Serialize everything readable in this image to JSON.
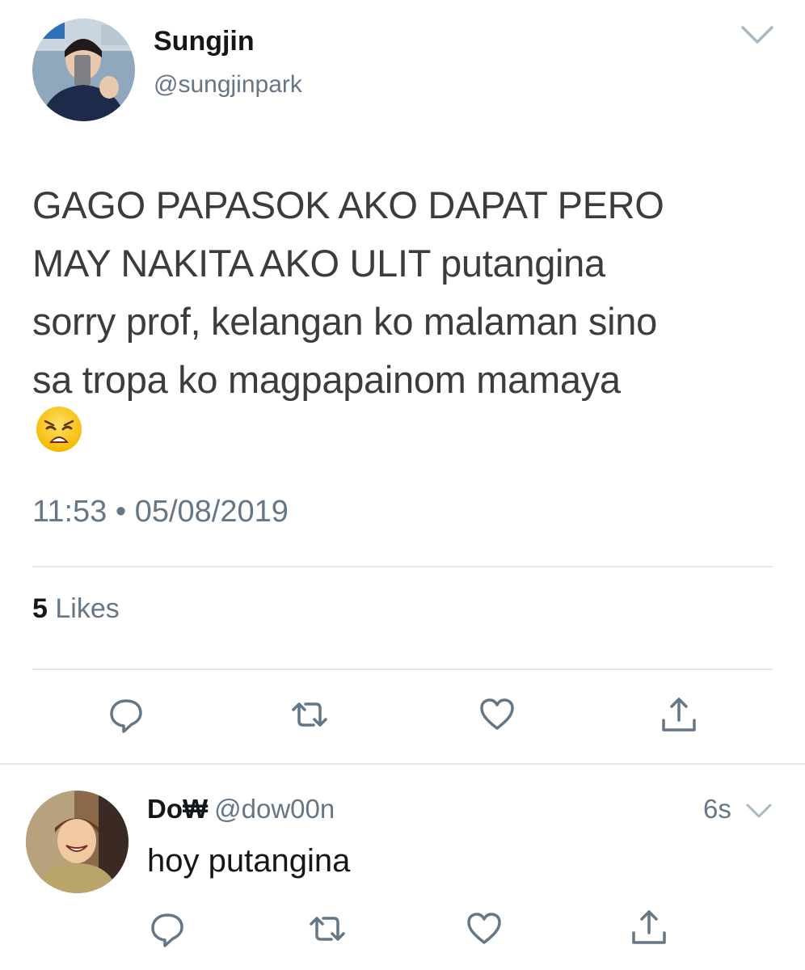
{
  "tweet": {
    "author": {
      "display_name": "Sungjin",
      "handle": "@sungjinpark",
      "avatar_icon": "profile-photo-mirror-selfie"
    },
    "text_lines": [
      "GAGO PAPASOK AKO DAPAT PERO",
      "MAY NAKITA AKO ULIT putangina",
      "sorry prof, kelangan ko malaman sino",
      "sa tropa ko magpapainom mamaya"
    ],
    "emoji": "weary-face-emoji",
    "timestamp": "11:53 • 05/08/2019",
    "likes": {
      "count": "5",
      "label": "Likes"
    },
    "actions": [
      "reply-icon",
      "retweet-icon",
      "like-icon",
      "share-icon"
    ]
  },
  "reply": {
    "author": {
      "display_name": "Do₩",
      "handle": "@dow00n",
      "avatar_icon": "profile-photo-laughing"
    },
    "time": "6s",
    "text": "hoy putangina",
    "actions": [
      "reply-icon",
      "retweet-icon",
      "like-icon",
      "share-icon"
    ]
  },
  "colors": {
    "primary_text": "#14171a",
    "secondary_text": "#657786",
    "divider": "#e1e8ed",
    "icon": "#657786"
  }
}
